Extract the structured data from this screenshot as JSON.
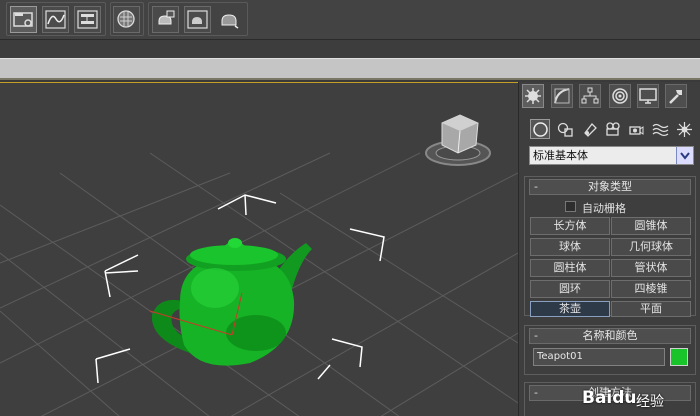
{
  "toolbar": {
    "icons": [
      "scene-explorer-icon",
      "curve-editor-icon",
      "schematic-view-icon",
      "material-editor-icon",
      "render-setup-icon",
      "rendered-frame-icon",
      "quick-render-icon"
    ]
  },
  "command_panel": {
    "tabs": [
      "create-icon",
      "modify-icon",
      "hierarchy-icon",
      "motion-icon",
      "display-icon",
      "utilities-icon"
    ],
    "subtabs": [
      "geometry-icon",
      "shapes-icon",
      "lights-icon",
      "cameras-icon",
      "helpers-icon",
      "spacewarps-icon",
      "systems-icon"
    ],
    "category": "标准基本体",
    "object_type": {
      "title": "对象类型",
      "autogrid_label": "自动栅格",
      "buttons": [
        "长方体",
        "圆锥体",
        "球体",
        "几何球体",
        "圆柱体",
        "管状体",
        "圆环",
        "四棱锥",
        "茶壶",
        "平面"
      ],
      "selected": "茶壶"
    },
    "name_color": {
      "title": "名称和颜色",
      "name_value": "Teapot01",
      "color": "#19c32a"
    },
    "creation_method": {
      "title": "创建方法"
    }
  },
  "viewport": {
    "object_color": "#19c32a",
    "selection_highlight": "#c69f28"
  },
  "watermark": {
    "brand": "Bai",
    "brand2": "du",
    "suffix": "经验"
  }
}
